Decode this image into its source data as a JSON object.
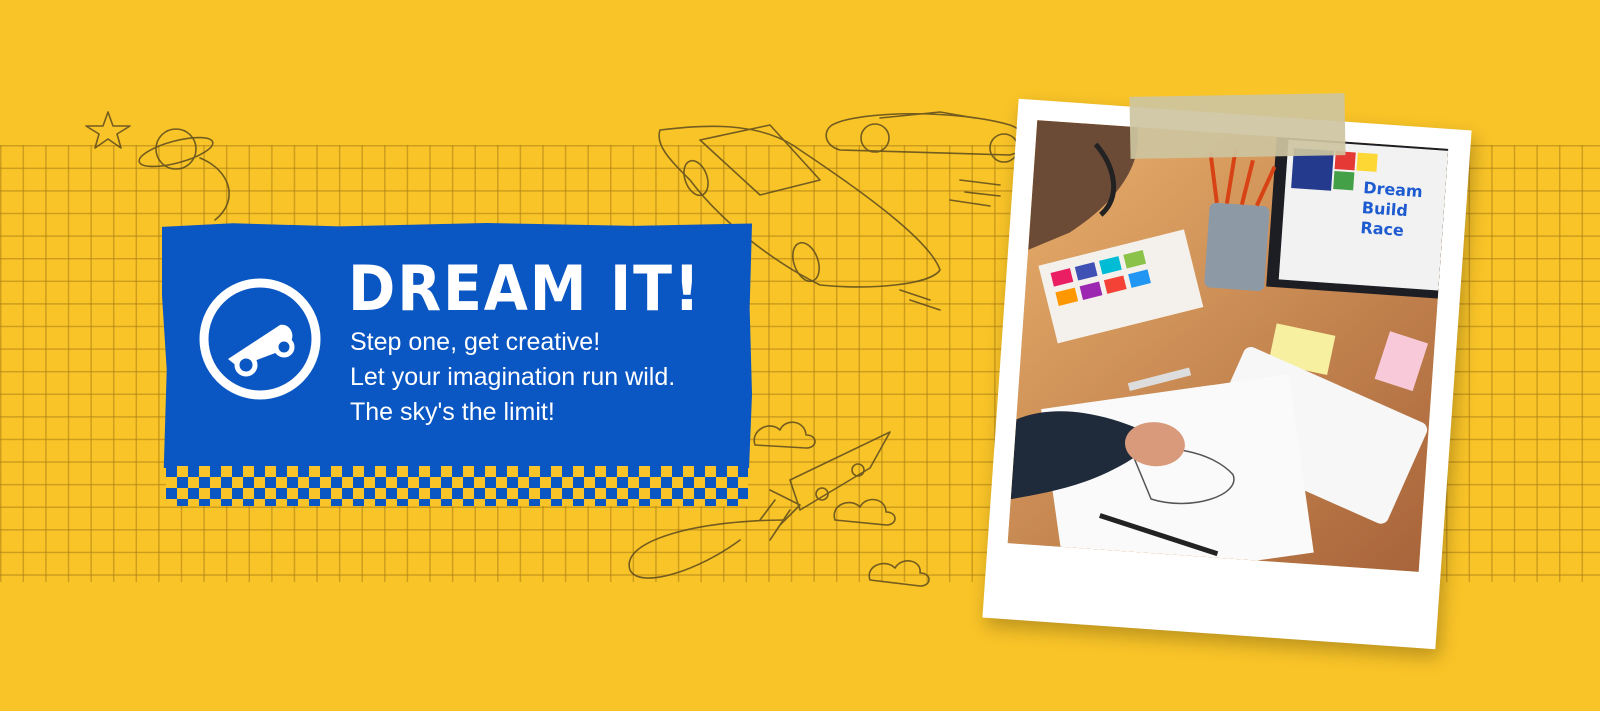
{
  "hero": {
    "title": "DREAM IT!",
    "lines": [
      "Step one, get creative!",
      "Let your imagination run wild.",
      "The sky's the limit!"
    ],
    "icon": "race-car-icon"
  },
  "photo": {
    "screen_text": [
      "Dream",
      "Build",
      "Race"
    ]
  },
  "colors": {
    "background": "#f9c428",
    "panel": "#0a56c2",
    "text": "#ffffff",
    "grid": "#aa7d14"
  }
}
